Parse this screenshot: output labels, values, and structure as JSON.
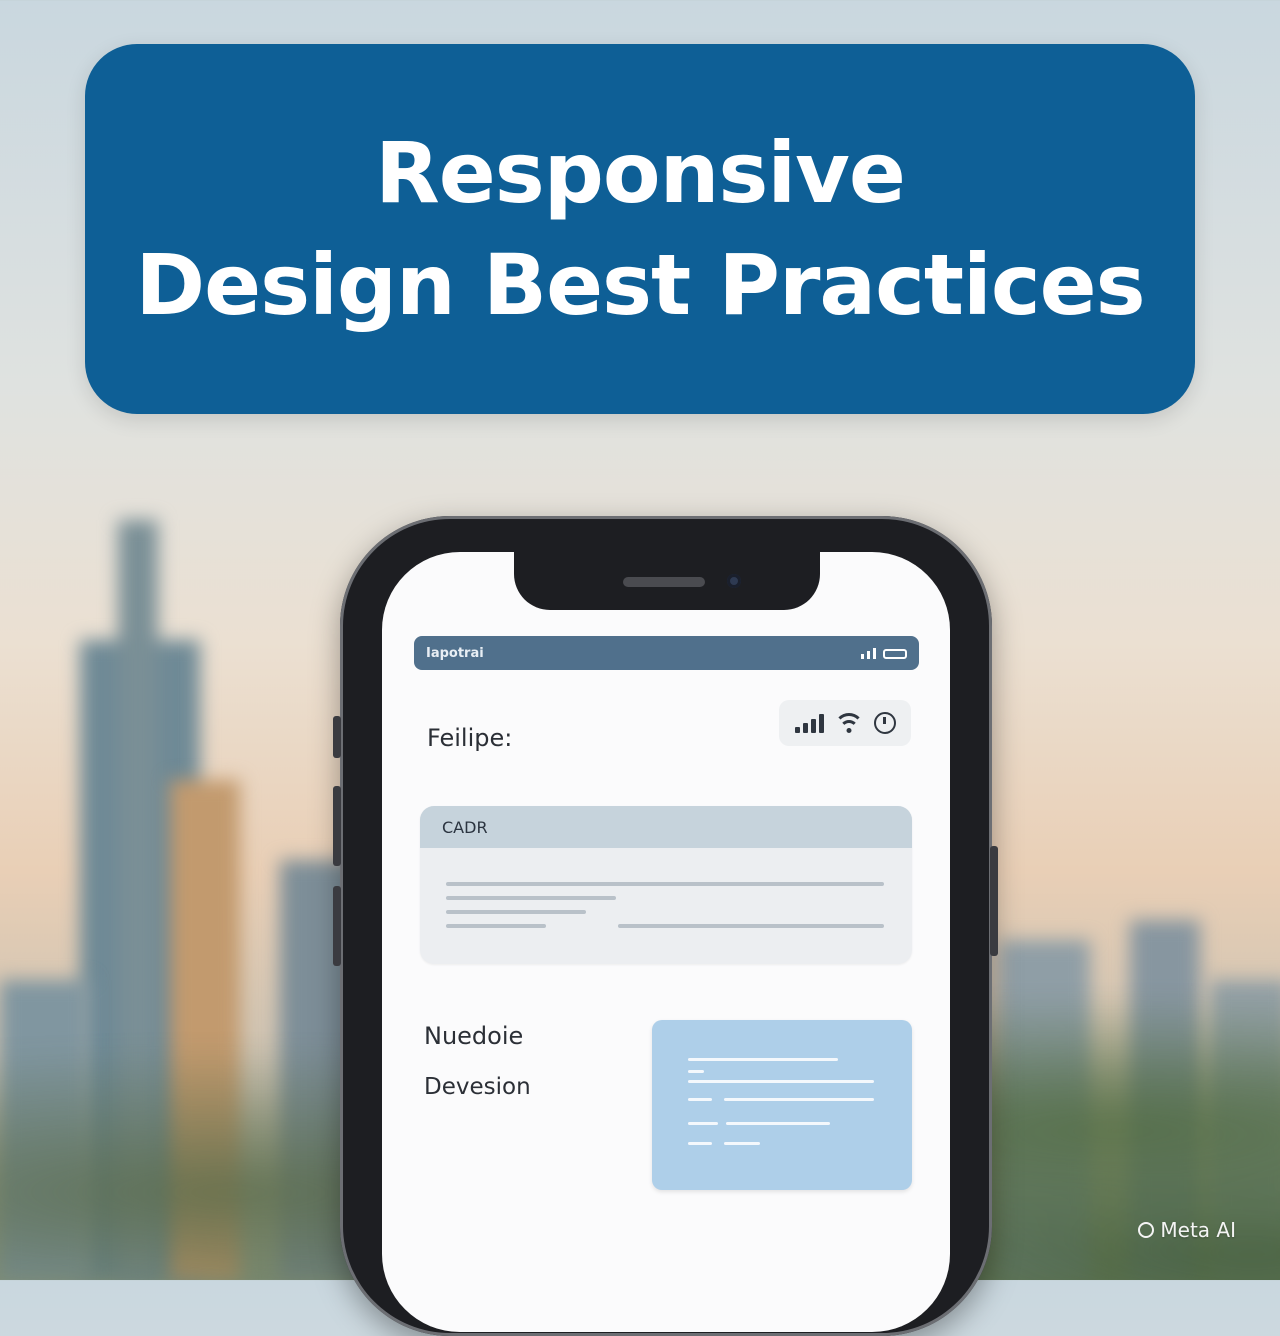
{
  "title": {
    "line1": "Responsive",
    "line2": "Design Best Practices"
  },
  "phone": {
    "status_bar_label": "Iapotrai",
    "field_label": "Feilipe:",
    "status_icons": [
      "signal-icon",
      "wifi-icon",
      "clock-icon"
    ],
    "card": {
      "header": "CADR"
    },
    "labels": [
      "Nuedoie",
      "Devesion"
    ]
  },
  "watermark": "Meta AI",
  "colors": {
    "banner": "#0e5f96",
    "status_bar": "#50708c",
    "card_header": "#c6d3dc",
    "blue_card": "#aecfe9"
  }
}
